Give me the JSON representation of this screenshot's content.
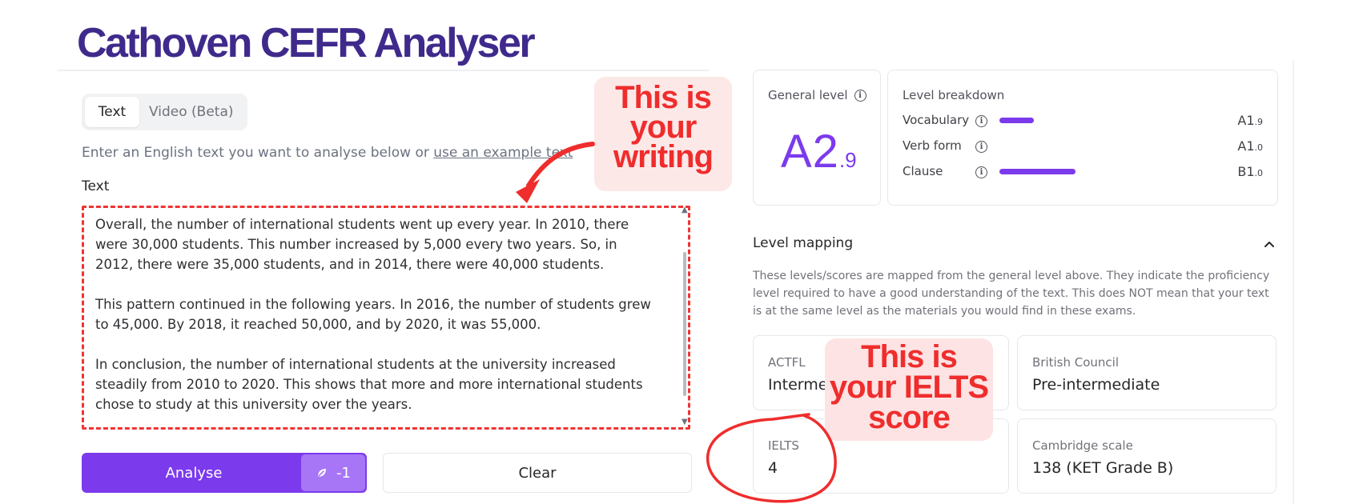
{
  "app_title": "Cathoven CEFR Analyser",
  "tabs": [
    {
      "label": "Text",
      "active": true
    },
    {
      "label": "Video (Beta)",
      "active": false
    }
  ],
  "instructions": {
    "prefix": "Enter an English text you want to analyse below or ",
    "link": "use an example text"
  },
  "text_field": {
    "label": "Text",
    "paragraphs": [
      "Overall, the number of international students went up every year. In 2010, there were 30,000 students. This number increased by 5,000 every two years. So, in 2012, there were 35,000 students, and in 2014, there were 40,000 students.",
      "This pattern continued in the following years. In 2016, the number of students grew to 45,000. By 2018, it reached 50,000, and by 2020, it was 55,000.",
      "In conclusion, the number of international students at the university increased steadily from 2010 to 2020. This shows that more and more international students chose to study at this university over the years."
    ]
  },
  "buttons": {
    "analyse": "Analyse",
    "credit_cost": "-1",
    "clear": "Clear"
  },
  "general_level": {
    "label": "General level",
    "main": "A2",
    "decimal": ".9"
  },
  "level_breakdown": {
    "title": "Level breakdown",
    "items": [
      {
        "name": "Vocabulary",
        "level": "A1",
        "decimal": ".9",
        "bar_fraction": 0.45
      },
      {
        "name": "Verb form",
        "level": "A1",
        "decimal": ".0",
        "bar_fraction": 0.0
      },
      {
        "name": "Clause",
        "level": "B1",
        "decimal": ".0",
        "bar_fraction": 1.0
      }
    ]
  },
  "level_mapping": {
    "title": "Level mapping",
    "description": "These levels/scores are mapped from the general level above. They indicate the proficiency level required to have a good understanding of the text. This does NOT mean that your text is at the same level as the materials you would find in these exams.",
    "cards": [
      {
        "label": "ACTFL",
        "value": "Intermediate"
      },
      {
        "label": "British Council",
        "value": "Pre-intermediate"
      },
      {
        "label": "IELTS",
        "value": "4"
      },
      {
        "label": "Cambridge scale",
        "value": "138 (KET Grade B)"
      }
    ]
  },
  "annotations": {
    "writing_callout": [
      "This is",
      "your",
      "writing"
    ],
    "ielts_callout": [
      "This is",
      "your IELTS",
      "score"
    ]
  },
  "colors": {
    "accent": "#7c3aed",
    "title": "#3f2a8c",
    "annotation_red": "#ef2d2d",
    "annotation_bg": "#fde8e8"
  }
}
